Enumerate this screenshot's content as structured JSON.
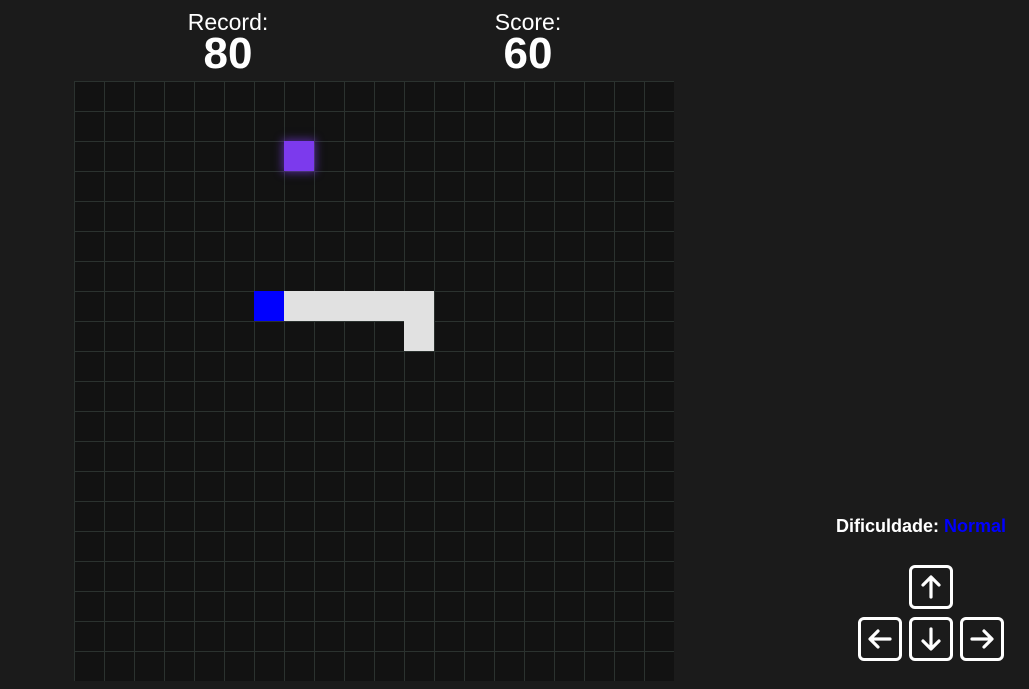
{
  "scoreboard": {
    "record_label": "Record:",
    "record_value": "80",
    "score_label": "Score:",
    "score_value": "60"
  },
  "board": {
    "columns": 20,
    "rows": 20,
    "snake_head": {
      "col": 6,
      "row": 7
    },
    "snake_body": [
      {
        "col": 7,
        "row": 7
      },
      {
        "col": 8,
        "row": 7
      },
      {
        "col": 9,
        "row": 7
      },
      {
        "col": 10,
        "row": 7
      },
      {
        "col": 11,
        "row": 7
      },
      {
        "col": 11,
        "row": 8
      }
    ],
    "food": {
      "col": 7,
      "row": 2
    }
  },
  "difficulty": {
    "label": "Dificuldade:",
    "value": "Normal"
  },
  "controls": {
    "up": "arrow-up-icon",
    "left": "arrow-left-icon",
    "down": "arrow-down-icon",
    "right": "arrow-right-icon"
  },
  "colors": {
    "background": "#1b1b1b",
    "board": "#121212",
    "grid_line": "#2b322f",
    "snake_head": "#0000ff",
    "snake_body": "#e1e1e1",
    "food": "#7c3aed",
    "difficulty_value": "#0000ff"
  }
}
